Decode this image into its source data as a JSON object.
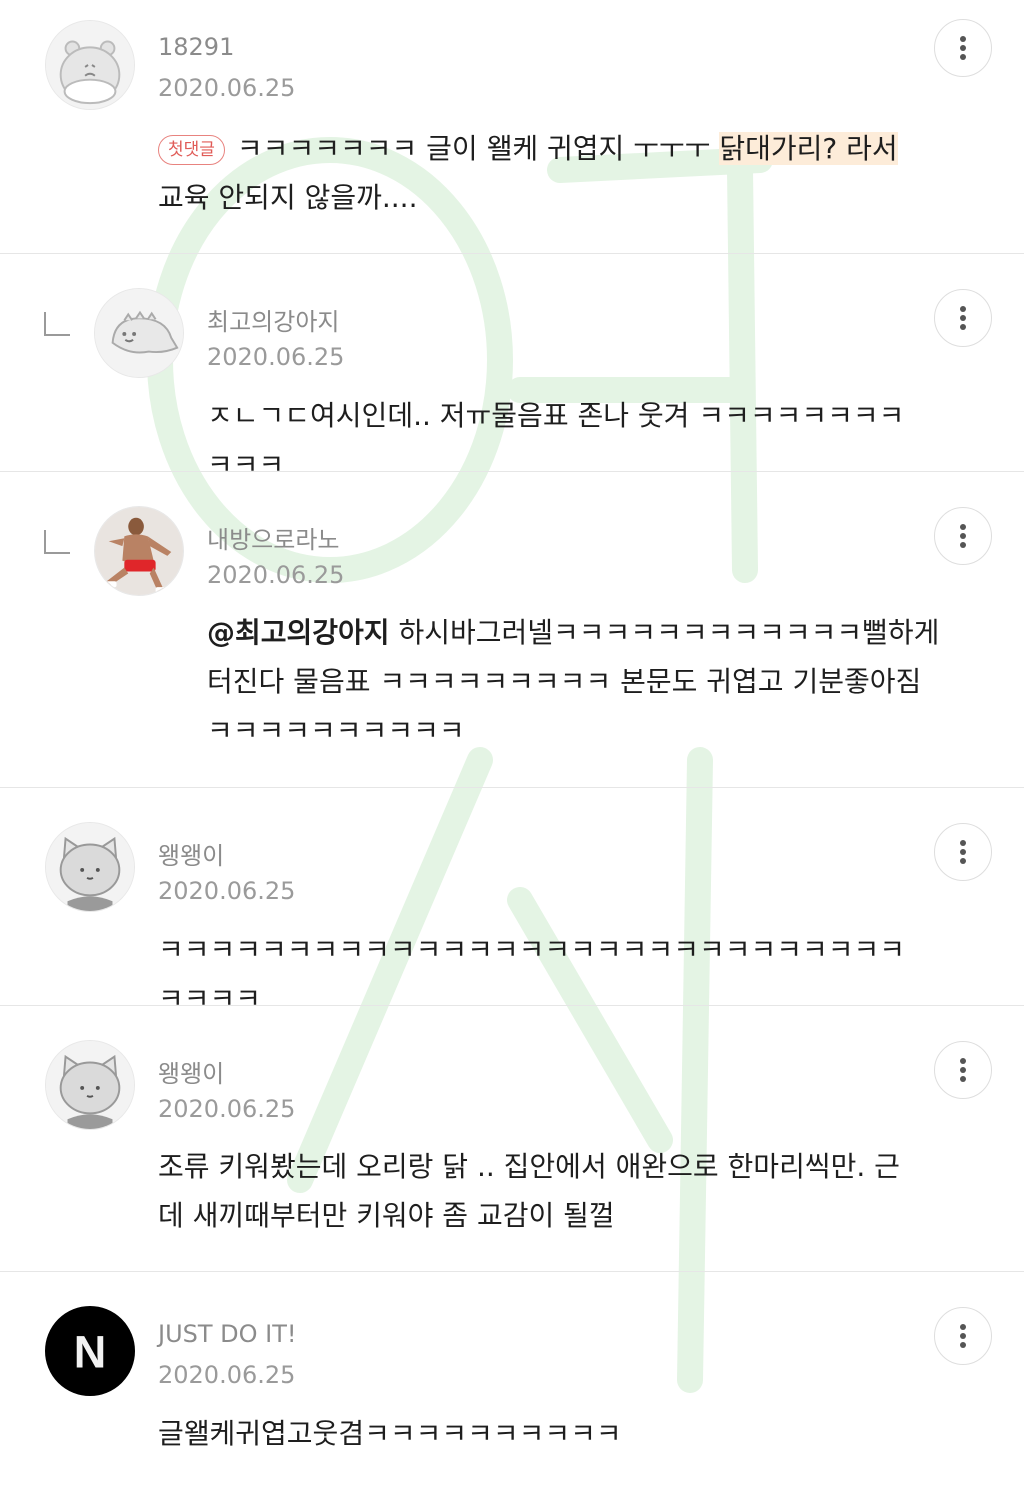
{
  "comments": [
    {
      "author": "18291",
      "date": "2020.06.25",
      "badge": "첫댓글",
      "text_a": "ㅋㅋㅋㅋㅋㅋㅋ 글이 왤케 귀엽지 ㅜㅜㅜ ",
      "text_hl": "닭대가리? 라서",
      "text_b": " 교육 안되지 않을까....",
      "avatar_icon": "hippo-avatar-icon"
    },
    {
      "author": "최고의강아지",
      "date": "2020.06.25",
      "text": "ㅈㄴㄱㄷ여시인데.. 저ㅠ물음표 존나 웃겨 ㅋㅋㅋㅋㅋㅋㅋㅋㅋㅋㅋ",
      "avatar_icon": "dinosaur-avatar-icon"
    },
    {
      "author": "내방으로라노",
      "date": "2020.06.25",
      "mention": "@최고의강아지",
      "text": " 하시바그러넬ㅋㅋㅋㅋㅋㅋㅋㅋㅋㅋㅋㅋ뻘하게터진다 물음표 ㅋㅋㅋㅋㅋㅋㅋㅋㅋ 본문도 귀엽고 기분좋아짐ㅋㅋㅋㅋㅋㅋㅋㅋㅋㅋ",
      "avatar_icon": "photo-avatar-icon"
    },
    {
      "author": "왱왱이",
      "date": "2020.06.25",
      "text": "ㅋㅋㅋㅋㅋㅋㅋㅋㅋㅋㅋㅋㅋㅋㅋㅋㅋㅋㅋㅋㅋㅋㅋㅋㅋㅋㅋㅋㅋㅋㅋㅋㅋ",
      "avatar_icon": "cat-avatar-icon"
    },
    {
      "author": "왱왱이",
      "date": "2020.06.25",
      "text": "조류 키워봤는데 오리랑 닭 .. 집안에서 애완으로 한마리씩만. 근데 새끼때부터만 키워야 좀 교감이 될껄",
      "avatar_icon": "cat-avatar-icon"
    },
    {
      "author": "JUST DO IT!",
      "date": "2020.06.25",
      "text": "글왤케귀엽고웃겸ㅋㅋㅋㅋㅋㅋㅋㅋㅋㅋ",
      "avatar_icon": "n-logo-avatar-icon",
      "avatar_letter": "N"
    }
  ],
  "icons": {
    "more": "more-vertical-icon",
    "reply": "reply-arrow-icon"
  },
  "colors": {
    "badge": "#e05b57",
    "highlight": "#fdecd9",
    "watermark": "#d8f0d8"
  }
}
